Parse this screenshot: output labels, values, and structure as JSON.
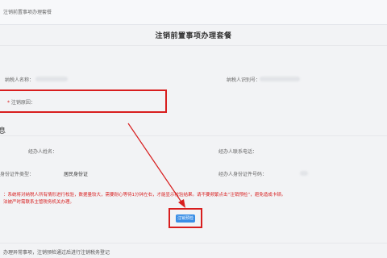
{
  "breadcrumb": "注销前置事项办理套餐",
  "page_title": "注销前置事项办理套餐",
  "fields": {
    "taxpayer_name_label": "纳税人名称：",
    "taxpayer_id_label": "纳税人识别号：",
    "required_mark": "*",
    "cancel_reason_label": "注销原因：",
    "agent_name_label": "经办人姓名：",
    "agent_phone_label": "经办人联系电话：",
    "id_type_label": "身份证件类型：",
    "id_type_value": "居民身份证",
    "id_number_label": "经办人身份证件号码："
  },
  "section_title": "息",
  "notice_lines": [
    "：系统将对纳税人所有情形进行校验，数据量较大，需要耐心等待1分钟左右，才能显示校验结果。请不要频繁点击“注销预检”，避免造成卡顿。",
    "法被严时需联系主管税务机关办理。"
  ],
  "submit_label": "注销预检",
  "footer_text": "办理异常事项，注销预检通过后进行注销税务登记",
  "colors": {
    "highlight": "#d81e1e",
    "button": "#3a8ee6"
  }
}
